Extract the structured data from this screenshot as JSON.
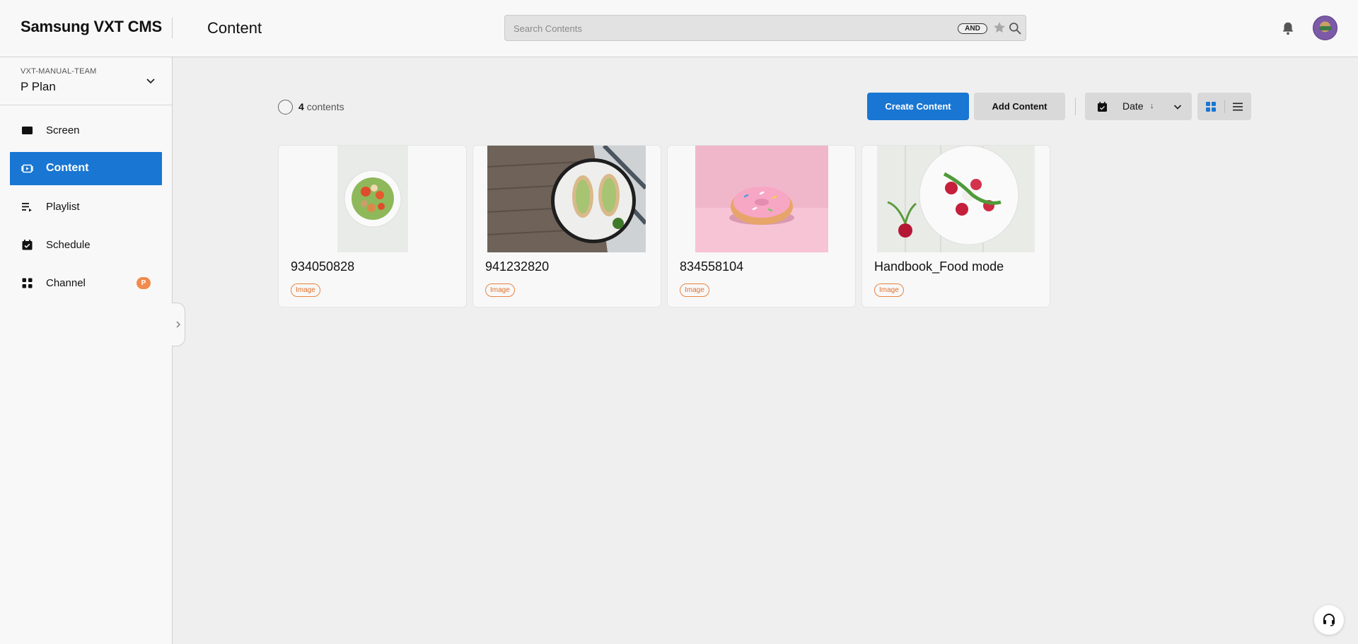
{
  "header": {
    "brand": "Samsung VXT CMS",
    "page_title": "Content",
    "search_placeholder": "Search Contents",
    "search_mode": "AND"
  },
  "sidebar": {
    "workspace_label": "VXT-MANUAL-TEAM",
    "workspace_name": "P Plan",
    "items": [
      {
        "label": "Screen",
        "icon": "screen-icon",
        "active": false
      },
      {
        "label": "Content",
        "icon": "content-icon",
        "active": true
      },
      {
        "label": "Playlist",
        "icon": "playlist-icon",
        "active": false
      },
      {
        "label": "Schedule",
        "icon": "schedule-icon",
        "active": false
      },
      {
        "label": "Channel",
        "icon": "channel-icon",
        "active": false,
        "badge": "P"
      }
    ]
  },
  "toolbar": {
    "count_value": "4",
    "count_label": "contents",
    "create_label": "Create Content",
    "add_label": "Add Content",
    "sort_label": "Date",
    "sort_direction": "↓"
  },
  "contents": [
    {
      "title": "934050828",
      "type": "Image"
    },
    {
      "title": "941232820",
      "type": "Image"
    },
    {
      "title": "834558104",
      "type": "Image"
    },
    {
      "title": "Handbook_Food mode",
      "type": "Image"
    }
  ],
  "colors": {
    "accent": "#1976d2",
    "badge": "#f28a4c",
    "type_badge": "#e0702a"
  }
}
